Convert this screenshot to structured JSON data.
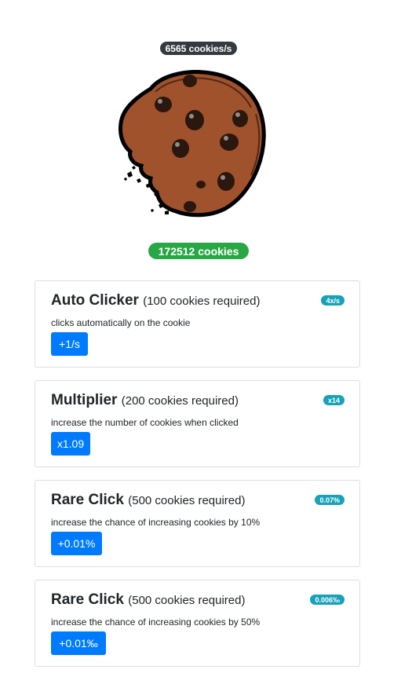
{
  "cookies_per_second": "6565 cookies/s",
  "cookie": {
    "icon": "cookie-icon",
    "colors": {
      "dough": "#a0522d",
      "outline": "#000000",
      "chips": "#2a170d"
    }
  },
  "cookie_count": "172512 cookies",
  "colors": {
    "rate_badge": "#343a40",
    "count_badge": "#28a745",
    "button": "#007bff",
    "upgrade_badge": "#17a2b8"
  },
  "upgrades": [
    {
      "title": "Auto Clicker",
      "requirement": "(100 cookies required)",
      "description": "clicks automatically on the cookie",
      "button": "+1/s",
      "badge": "4x/s"
    },
    {
      "title": "Multiplier",
      "requirement": "(200 cookies required)",
      "description": "increase the number of cookies when clicked",
      "button": "x1.09",
      "badge": "x14"
    },
    {
      "title": "Rare Click",
      "requirement": "(500 cookies required)",
      "description": "increase the chance of increasing cookies by 10%",
      "button": "+0.01%",
      "badge": "0.07%"
    },
    {
      "title": "Rare Click",
      "requirement": "(500 cookies required)",
      "description": "increase the chance of increasing cookies by 50%",
      "button": "+0.01‰",
      "badge": "0.006‰"
    }
  ]
}
